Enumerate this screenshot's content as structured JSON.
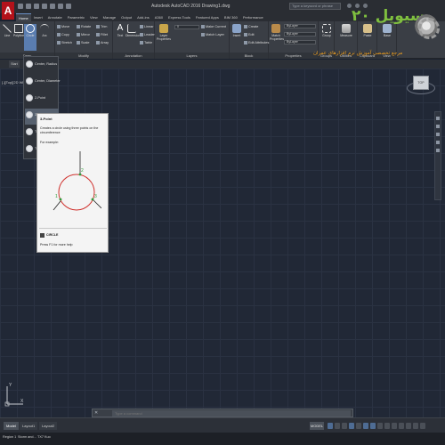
{
  "window": {
    "title": "Autodesk AutoCAD 2016  Drawing1.dwg",
    "search_placeholder": "Type a keyword or phrase"
  },
  "ribbon_tabs": [
    "Home",
    "Insert",
    "Annotate",
    "Parametric",
    "View",
    "Manage",
    "Output",
    "Add-ins",
    "A360",
    "Express Tools",
    "Featured Apps",
    "BIM 360",
    "Performance"
  ],
  "ribbon": {
    "draw": {
      "title": "Draw",
      "buttons": [
        "Line",
        "Polyline",
        "Circle",
        "Arc"
      ]
    },
    "modify": {
      "title": "Modify",
      "rows": [
        "Move",
        "Rotate",
        "Trim",
        "Copy",
        "Mirror",
        "Fillet",
        "Stretch",
        "Scale",
        "Array"
      ]
    },
    "annotation": {
      "title": "Annotation",
      "buttons": [
        "Text",
        "Dimension"
      ],
      "rows": [
        "Linear",
        "Leader",
        "Table"
      ]
    },
    "layers": {
      "title": "Layers",
      "buttons": [
        "Layer Properties"
      ],
      "rows": [
        "Make Current",
        "Match Layer"
      ]
    },
    "block": {
      "title": "Block",
      "buttons": [
        "Insert"
      ],
      "rows": [
        "Create",
        "Edit",
        "Edit Attributes"
      ]
    },
    "properties": {
      "title": "Properties",
      "buttons": [
        "Match Properties"
      ],
      "combos": [
        "ByLayer",
        "ByLayer",
        "ByLayer"
      ]
    },
    "groups": {
      "title": "Groups",
      "buttons": [
        "Group"
      ]
    },
    "utilities": {
      "title": "Utilities",
      "buttons": [
        "Measure"
      ]
    },
    "clipboard": {
      "title": "Clipboard",
      "buttons": [
        "Paste"
      ]
    },
    "view": {
      "title": "View",
      "buttons": [
        "Base"
      ]
    }
  },
  "watermark": {
    "title": "سیویل ۲۰",
    "subtitle": "مرجع تخصصی آموزش نرم افزارهای عمران"
  },
  "file_tabs": {
    "start": "Start"
  },
  "viewport_label": "[-][Top][2D Wireframe]",
  "viewcube": {
    "face": "TOP"
  },
  "circle_menu": {
    "items": [
      "Center, Radius",
      "Center, Diameter",
      "2-Point",
      "3-Point",
      "Tan, Tan, Radius",
      "Tan, Tan, Tan"
    ],
    "selected_index": 3
  },
  "tooltip": {
    "title": "3-Point",
    "description": "Creates a circle using three points on the circumference",
    "example_label": "For example:",
    "figure_labels": [
      "1",
      "2",
      "3"
    ],
    "command": "CIRCLE",
    "help": "Press F1 for more help"
  },
  "ucs": {
    "x": "X",
    "y": "Y"
  },
  "command_line": {
    "placeholder": "Type a command",
    "close": "✕"
  },
  "layout_tabs": [
    "Model",
    "Layout1",
    "Layout2"
  ],
  "status": {
    "model": "MODEL"
  },
  "taskbar": [
    "Region 1",
    "Storm and...",
    "TX7 Kuo"
  ],
  "colors": {
    "canvas": "#212836",
    "ribbon": "#3a3e45",
    "accent": "#4e6c94",
    "watermark_green": "#7fbf3f",
    "watermark_orange": "#f0a020",
    "circle_red": "#d0312d"
  }
}
